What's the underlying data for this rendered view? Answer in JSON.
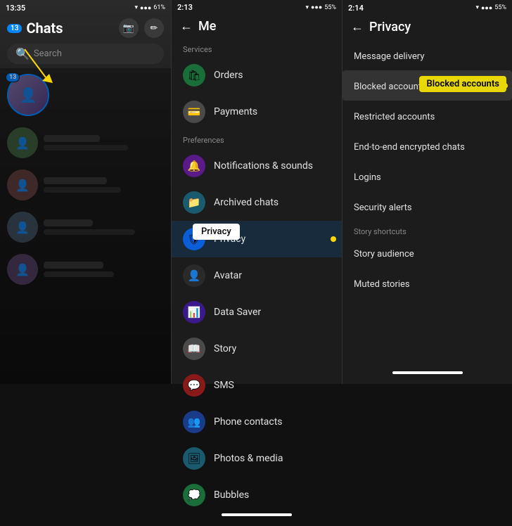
{
  "panel1": {
    "status_time": "13:35",
    "title": "Chats",
    "badge": "13",
    "avatar_badge": "13",
    "search_placeholder": "Search"
  },
  "panel2": {
    "status_time": "2:13",
    "title": "Me",
    "sections": {
      "services_label": "Services",
      "preferences_label": "Preferences"
    },
    "items": [
      {
        "label": "Orders",
        "icon": "🛍",
        "icon_class": "icon-green"
      },
      {
        "label": "Payments",
        "icon": "💳",
        "icon_class": "icon-gray"
      },
      {
        "label": "Notifications & sounds",
        "icon": "🔔",
        "icon_class": "icon-purple"
      },
      {
        "label": "Archived chats",
        "icon": "📁",
        "icon_class": "icon-teal"
      },
      {
        "label": "Privacy",
        "icon": "🛡",
        "icon_class": "icon-blue",
        "highlight": true
      },
      {
        "label": "Avatar",
        "icon": "👤",
        "icon_class": "icon-dark"
      },
      {
        "label": "Data Saver",
        "icon": "📊",
        "icon_class": "icon-indigo"
      },
      {
        "label": "Story",
        "icon": "📖",
        "icon_class": "icon-gray"
      },
      {
        "label": "SMS",
        "icon": "💬",
        "icon_class": "icon-red"
      },
      {
        "label": "Phone contacts",
        "icon": "👥",
        "icon_class": "icon-blue"
      },
      {
        "label": "Photos & media",
        "icon": "🖼",
        "icon_class": "icon-teal"
      },
      {
        "label": "Bubbles",
        "icon": "💭",
        "icon_class": "icon-green"
      }
    ],
    "tooltip": "Privacy"
  },
  "panel3": {
    "status_time": "2:14",
    "title": "Privacy",
    "items": [
      {
        "label": "Message delivery",
        "section": null
      },
      {
        "label": "Blocked accounts",
        "section": null,
        "highlight": true
      },
      {
        "label": "Restricted accounts",
        "section": null
      },
      {
        "label": "End-to-end encrypted chats",
        "section": null
      },
      {
        "label": "Logins",
        "section": null
      },
      {
        "label": "Security alerts",
        "section": null
      },
      {
        "label": "Story shortcuts",
        "section": "Story shortcuts"
      },
      {
        "label": "Story audience",
        "section": null
      },
      {
        "label": "Muted stories",
        "section": null
      }
    ],
    "tooltip": "Blocked accounts"
  }
}
